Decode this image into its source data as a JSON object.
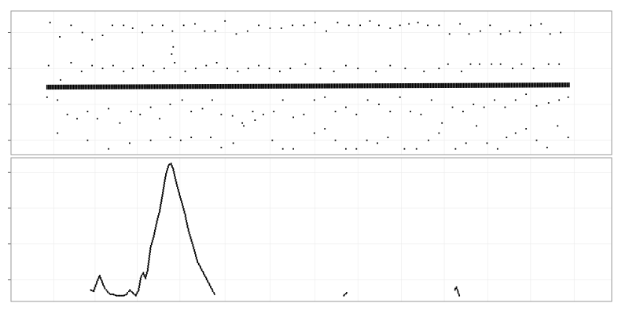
{
  "chart_data": [
    {
      "type": "scatter",
      "panel": "top",
      "title": "",
      "xlabel": "",
      "ylabel": "",
      "grid": true,
      "legend": "none",
      "colors": {
        "panel_border": "#999999",
        "grid": "#ebebeb",
        "point": "#000000"
      },
      "xlim": [
        0,
        800
      ],
      "ylim": [
        0,
        100
      ],
      "yticks": [
        10,
        35,
        60,
        85
      ],
      "xgrid": [
        57,
        112,
        168,
        225,
        285,
        345,
        405,
        462,
        520,
        577,
        635,
        692,
        750
      ],
      "band": {
        "x_start": 48,
        "x_end": 745,
        "y_center_left": 47,
        "y_center_right": 48.5,
        "y_spread": 2.4,
        "step": 2.2
      },
      "outliers": [
        [
          52,
          92
        ],
        [
          65,
          82
        ],
        [
          80,
          90
        ],
        [
          95,
          85
        ],
        [
          108,
          80
        ],
        [
          122,
          83
        ],
        [
          135,
          90
        ],
        [
          150,
          90
        ],
        [
          162,
          88
        ],
        [
          175,
          85
        ],
        [
          188,
          90
        ],
        [
          202,
          90
        ],
        [
          215,
          86
        ],
        [
          230,
          90
        ],
        [
          245,
          91
        ],
        [
          258,
          86
        ],
        [
          272,
          86
        ],
        [
          285,
          93
        ],
        [
          300,
          84
        ],
        [
          315,
          86
        ],
        [
          330,
          90
        ],
        [
          345,
          88
        ],
        [
          360,
          88
        ],
        [
          375,
          90
        ],
        [
          390,
          90
        ],
        [
          405,
          92
        ],
        [
          420,
          86
        ],
        [
          435,
          92
        ],
        [
          450,
          90
        ],
        [
          465,
          90
        ],
        [
          478,
          93
        ],
        [
          490,
          90
        ],
        [
          505,
          88
        ],
        [
          518,
          90
        ],
        [
          530,
          91
        ],
        [
          542,
          92
        ],
        [
          555,
          90
        ],
        [
          570,
          90
        ],
        [
          584,
          84
        ],
        [
          598,
          91
        ],
        [
          610,
          84
        ],
        [
          625,
          86
        ],
        [
          638,
          90
        ],
        [
          652,
          84
        ],
        [
          664,
          86
        ],
        [
          678,
          85
        ],
        [
          692,
          90
        ],
        [
          706,
          91
        ],
        [
          718,
          84
        ],
        [
          732,
          85
        ],
        [
          48,
          40
        ],
        [
          62,
          38
        ],
        [
          75,
          28
        ],
        [
          88,
          25
        ],
        [
          102,
          30
        ],
        [
          115,
          25
        ],
        [
          130,
          32
        ],
        [
          145,
          22
        ],
        [
          160,
          30
        ],
        [
          172,
          28
        ],
        [
          186,
          33
        ],
        [
          198,
          25
        ],
        [
          212,
          35
        ],
        [
          228,
          38
        ],
        [
          240,
          30
        ],
        [
          255,
          32
        ],
        [
          268,
          38
        ],
        [
          280,
          28
        ],
        [
          295,
          27
        ],
        [
          308,
          22
        ],
        [
          322,
          30
        ],
        [
          336,
          28
        ],
        [
          350,
          30
        ],
        [
          362,
          38
        ],
        [
          376,
          26
        ],
        [
          390,
          28
        ],
        [
          404,
          38
        ],
        [
          418,
          40
        ],
        [
          432,
          30
        ],
        [
          446,
          33
        ],
        [
          460,
          28
        ],
        [
          475,
          38
        ],
        [
          490,
          35
        ],
        [
          505,
          30
        ],
        [
          518,
          40
        ],
        [
          532,
          30
        ],
        [
          546,
          28
        ],
        [
          560,
          38
        ],
        [
          574,
          22
        ],
        [
          588,
          33
        ],
        [
          602,
          30
        ],
        [
          616,
          35
        ],
        [
          630,
          33
        ],
        [
          644,
          38
        ],
        [
          658,
          33
        ],
        [
          672,
          38
        ],
        [
          686,
          42
        ],
        [
          700,
          34
        ],
        [
          716,
          36
        ],
        [
          730,
          38
        ],
        [
          742,
          40
        ],
        [
          50,
          62
        ],
        [
          66,
          52
        ],
        [
          80,
          64
        ],
        [
          94,
          58
        ],
        [
          108,
          62
        ],
        [
          122,
          60
        ],
        [
          136,
          62
        ],
        [
          150,
          58
        ],
        [
          162,
          60
        ],
        [
          176,
          62
        ],
        [
          190,
          58
        ],
        [
          204,
          60
        ],
        [
          218,
          64
        ],
        [
          232,
          58
        ],
        [
          246,
          60
        ],
        [
          260,
          62
        ],
        [
          274,
          64
        ],
        [
          288,
          60
        ],
        [
          302,
          58
        ],
        [
          316,
          60
        ],
        [
          330,
          62
        ],
        [
          344,
          60
        ],
        [
          358,
          58
        ],
        [
          372,
          60
        ],
        [
          392,
          63
        ],
        [
          412,
          60
        ],
        [
          430,
          58
        ],
        [
          446,
          62
        ],
        [
          462,
          60
        ],
        [
          486,
          58
        ],
        [
          505,
          62
        ],
        [
          525,
          60
        ],
        [
          550,
          58
        ],
        [
          570,
          60
        ],
        [
          582,
          63
        ],
        [
          600,
          58
        ],
        [
          612,
          63
        ],
        [
          624,
          63
        ],
        [
          640,
          63
        ],
        [
          652,
          63
        ],
        [
          668,
          60
        ],
        [
          680,
          63
        ],
        [
          696,
          60
        ],
        [
          716,
          63
        ],
        [
          730,
          63
        ],
        [
          62,
          15
        ],
        [
          102,
          10
        ],
        [
          130,
          4
        ],
        [
          158,
          8
        ],
        [
          186,
          10
        ],
        [
          212,
          12
        ],
        [
          226,
          10
        ],
        [
          240,
          12
        ],
        [
          266,
          12
        ],
        [
          280,
          5
        ],
        [
          296,
          8
        ],
        [
          310,
          20
        ],
        [
          325,
          24
        ],
        [
          348,
          10
        ],
        [
          362,
          4
        ],
        [
          376,
          4
        ],
        [
          404,
          15
        ],
        [
          418,
          18
        ],
        [
          432,
          10
        ],
        [
          446,
          4
        ],
        [
          460,
          4
        ],
        [
          474,
          10
        ],
        [
          488,
          8
        ],
        [
          502,
          12
        ],
        [
          524,
          4
        ],
        [
          540,
          4
        ],
        [
          556,
          10
        ],
        [
          570,
          15
        ],
        [
          592,
          4
        ],
        [
          606,
          8
        ],
        [
          620,
          20
        ],
        [
          634,
          8
        ],
        [
          648,
          4
        ],
        [
          660,
          12
        ],
        [
          672,
          15
        ],
        [
          686,
          18
        ],
        [
          700,
          10
        ],
        [
          714,
          5
        ],
        [
          728,
          20
        ],
        [
          742,
          12
        ],
        [
          214,
          70
        ],
        [
          216,
          75
        ]
      ]
    },
    {
      "type": "scatter",
      "panel": "bottom",
      "title": "",
      "xlabel": "",
      "ylabel": "",
      "grid": true,
      "legend": "none",
      "colors": {
        "panel_border": "#999999",
        "grid": "#ebebeb",
        "point": "#000000"
      },
      "xlim": [
        0,
        800
      ],
      "ylim": [
        0,
        100
      ],
      "yticks": [
        15,
        40,
        65,
        90
      ],
      "xgrid": [
        57,
        112,
        168,
        225,
        285,
        345,
        405,
        462,
        520,
        577,
        635,
        692,
        750
      ],
      "series": [
        {
          "segments": [
            [
              106,
              8
            ],
            [
              110,
              7
            ],
            [
              114,
              13
            ],
            [
              118,
              18
            ],
            [
              121,
              14
            ],
            [
              124,
              10
            ],
            [
              128,
              7
            ],
            [
              132,
              5
            ],
            [
              136,
              5
            ],
            [
              140,
              4
            ],
            [
              144,
              4
            ],
            [
              148,
              4
            ],
            [
              150,
              4
            ],
            [
              154,
              5
            ],
            [
              158,
              8
            ],
            [
              162,
              6
            ],
            [
              166,
              4
            ],
            [
              170,
              8
            ],
            [
              173,
              17
            ],
            [
              176,
              20
            ],
            [
              179,
              16
            ],
            [
              182,
              22
            ],
            [
              186,
              38
            ],
            [
              190,
              45
            ],
            [
              194,
              55
            ],
            [
              198,
              63
            ],
            [
              202,
              75
            ],
            [
              206,
              88
            ],
            [
              210,
              95
            ],
            [
              213,
              96
            ],
            [
              216,
              92
            ],
            [
              220,
              83
            ],
            [
              224,
              75
            ],
            [
              228,
              68
            ],
            [
              232,
              60
            ],
            [
              236,
              50
            ],
            [
              240,
              43
            ],
            [
              244,
              36
            ],
            [
              248,
              28
            ],
            [
              252,
              24
            ],
            [
              256,
              20
            ],
            [
              260,
              16
            ],
            [
              264,
              12
            ],
            [
              268,
              8
            ],
            [
              271,
              5
            ]
          ]
        },
        {
          "segments": [
            [
              443,
              4
            ],
            [
              447,
              6
            ]
          ]
        },
        {
          "segments": [
            [
              591,
              8
            ],
            [
              593,
              10
            ],
            [
              595,
              7
            ],
            [
              597,
              4
            ]
          ]
        }
      ]
    }
  ]
}
